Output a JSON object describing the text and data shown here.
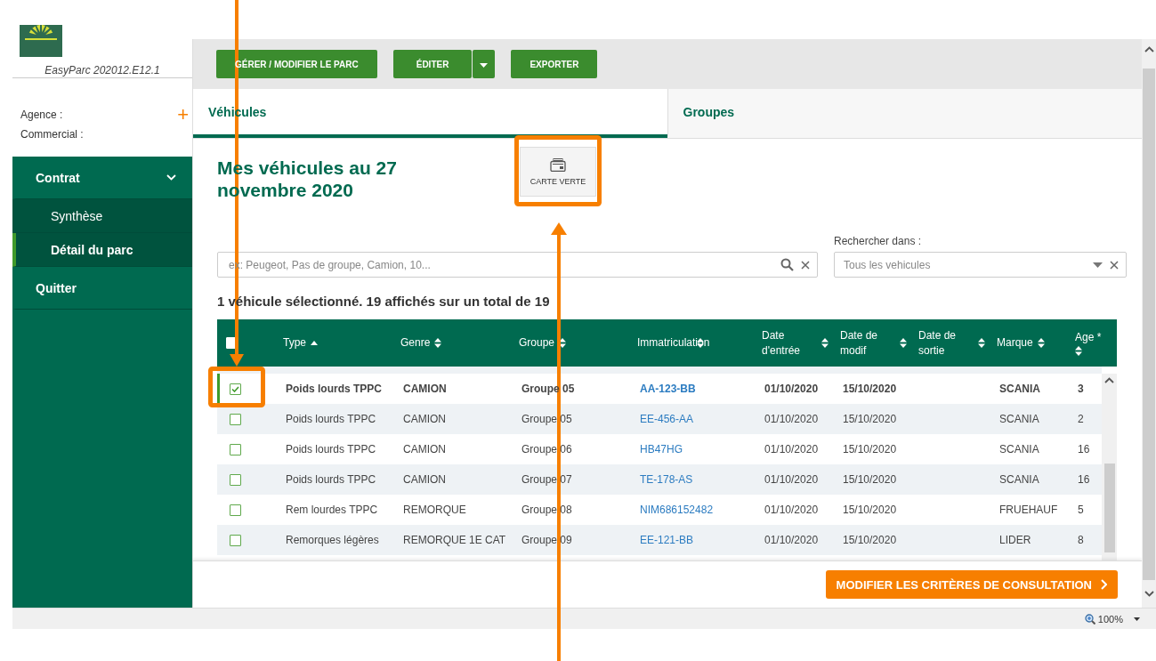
{
  "sidebar": {
    "version": "EasyParc 202012.E12.1",
    "agent_label": "Agence :",
    "sales_label": "Commercial :",
    "add_symbol": "+",
    "nav": [
      {
        "label": "Contrat",
        "kind": "section",
        "expanded": true,
        "selected": false
      },
      {
        "label": "Synthèse",
        "kind": "sub",
        "selected": false
      },
      {
        "label": "Détail du parc",
        "kind": "sub",
        "selected": true
      },
      {
        "label": "Quitter",
        "kind": "section",
        "selected": false
      }
    ]
  },
  "toolbar": {
    "buttons": [
      {
        "label": "GÉRER / MODIFIER LE PARC",
        "kind": "plain"
      },
      {
        "label": "ÉDITER",
        "kind": "split"
      },
      {
        "label": "EXPORTER",
        "kind": "plain"
      }
    ]
  },
  "tabs": [
    {
      "label": "Véhicules",
      "selected": true
    },
    {
      "label": "Groupes",
      "selected": false
    }
  ],
  "page_title": "Mes véhicules au 27 novembre 2020",
  "card_button": {
    "label": "CARTE VERTE"
  },
  "search": {
    "placeholder": "ex: Peugeot, Pas de groupe, Camion, 10...",
    "scope_label": "Rechercher dans :",
    "scope_value": "Tous les vehicules"
  },
  "summary": "1 véhicule sélectionné. 19 affichés sur un total de 19",
  "table": {
    "select_all": {
      "checked": false
    },
    "columns": [
      {
        "label": "Type",
        "sorted": true
      },
      {
        "label": "Genre",
        "sorted": false
      },
      {
        "label": "Groupe",
        "sorted": false
      },
      {
        "label": "Immatriculation",
        "sorted": false
      },
      {
        "label": "Date d'entrée",
        "sorted": false
      },
      {
        "label": "Date de modif",
        "sorted": false
      },
      {
        "label": "Date de sortie",
        "sorted": false
      },
      {
        "label": "Marque",
        "sorted": false
      },
      {
        "label": "Age *",
        "sorted": false
      }
    ],
    "rows": [
      {
        "selected": true,
        "checked": true,
        "cells": [
          "Poids lourds TPPC",
          "CAMION",
          "Groupe 05",
          "AA-123-BB",
          "01/10/2020",
          "15/10/2020",
          "",
          "SCANIA",
          "3"
        ]
      },
      {
        "selected": false,
        "checked": false,
        "cells": [
          "Poids lourds TPPC",
          "CAMION",
          "Groupe 05",
          "EE-456-AA",
          "01/10/2020",
          "15/10/2020",
          "",
          "SCANIA",
          "2"
        ]
      },
      {
        "selected": false,
        "checked": false,
        "cells": [
          "Poids lourds TPPC",
          "CAMION",
          "Groupe 06",
          "HB47HG",
          "01/10/2020",
          "15/10/2020",
          "",
          "SCANIA",
          "16"
        ]
      },
      {
        "selected": false,
        "checked": false,
        "cells": [
          "Poids lourds TPPC",
          "CAMION",
          "Groupe 07",
          "TE-178-AS",
          "01/10/2020",
          "15/10/2020",
          "",
          "SCANIA",
          "16"
        ]
      },
      {
        "selected": false,
        "checked": false,
        "cells": [
          "Rem lourdes TPPC",
          "REMORQUE",
          "Groupe 08",
          "NIM686152482",
          "01/10/2020",
          "15/10/2020",
          "",
          "FRUEHAUF",
          "5"
        ]
      },
      {
        "selected": false,
        "checked": false,
        "cells": [
          "Remorques légères",
          "REMORQUE 1E CAT",
          "Groupe 09",
          "EE-121-BB",
          "01/10/2020",
          "15/10/2020",
          "",
          "LIDER",
          "8"
        ]
      }
    ]
  },
  "footer_button": {
    "label": "MODIFIER LES CRITÈRES DE CONSULTATION"
  },
  "status_bar": {
    "zoom": "100%"
  }
}
